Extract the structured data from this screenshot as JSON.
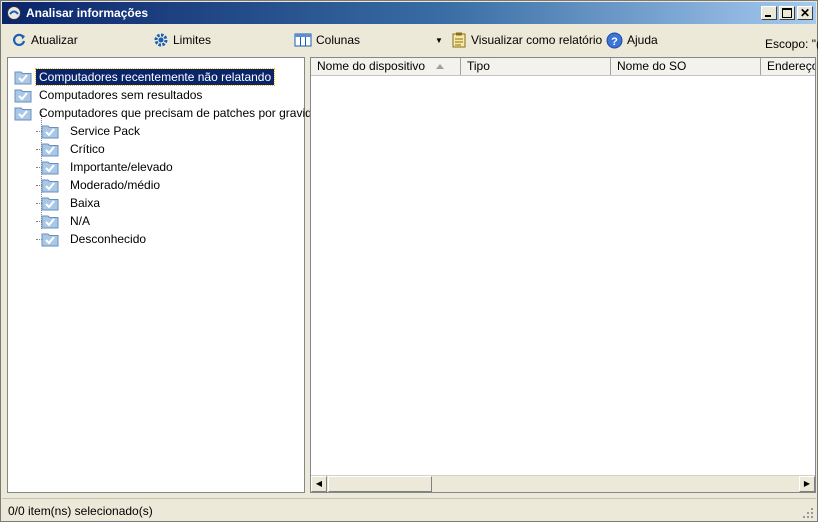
{
  "window": {
    "title": "Analisar informações"
  },
  "toolbar": {
    "refresh_label": "Atualizar",
    "limits_label": "Limites",
    "columns_label": "Colunas",
    "report_label": "Visualizar como relatório",
    "help_label": "Ajuda",
    "scope_label": "Escopo: \"("
  },
  "tree": {
    "items": [
      {
        "label": "Computadores recentemente não relatando",
        "selected": true,
        "icon": "folder-check-icon"
      },
      {
        "label": "Computadores sem resultados",
        "icon": "folder-check-icon"
      },
      {
        "label": "Computadores que precisam de patches por gravidade",
        "icon": "folder-check-icon"
      }
    ],
    "children": [
      {
        "label": "Service Pack",
        "icon": "folder-check-icon"
      },
      {
        "label": "Crítico",
        "icon": "folder-check-icon"
      },
      {
        "label": "Importante/elevado",
        "icon": "folder-check-icon"
      },
      {
        "label": "Moderado/médio",
        "icon": "folder-check-icon"
      },
      {
        "label": "Baixa",
        "icon": "folder-check-icon"
      },
      {
        "label": "N/A",
        "icon": "folder-check-icon"
      },
      {
        "label": "Desconhecido",
        "icon": "folder-check-icon"
      }
    ]
  },
  "table": {
    "columns": [
      "Nome do dispositivo",
      "Tipo",
      "Nome do SO",
      "Endereço"
    ],
    "sorted_column": "Nome do dispositivo",
    "rows": []
  },
  "status": {
    "text": "0/0 item(ns) selecionado(s)"
  },
  "colors": {
    "titlebar_start": "#0a246a",
    "selection": "#0a246a",
    "folder": "#a9c8e8"
  }
}
